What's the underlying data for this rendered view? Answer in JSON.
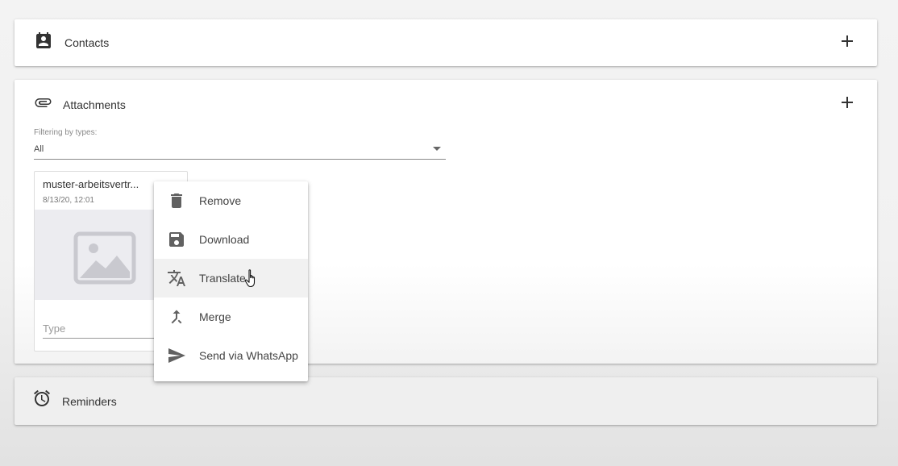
{
  "contacts": {
    "title": "Contacts",
    "icon": "contacts-icon",
    "add_icon": "plus-icon"
  },
  "attachments": {
    "title": "Attachments",
    "icon": "paperclip-icon",
    "add_icon": "plus-icon",
    "filter": {
      "label": "Filtering by types:",
      "value": "All"
    },
    "card": {
      "name": "muster-arbeitsvertr...",
      "date": "8/13/20, 12:01",
      "thumbnail_icon": "image-placeholder-icon",
      "type_placeholder": "Type"
    }
  },
  "context_menu": {
    "items": [
      {
        "label": "Remove",
        "icon": "trash-icon"
      },
      {
        "label": "Download",
        "icon": "save-icon"
      },
      {
        "label": "Translate",
        "icon": "translate-icon"
      },
      {
        "label": "Merge",
        "icon": "merge-icon"
      },
      {
        "label": "Send via WhatsApp",
        "icon": "send-icon"
      }
    ],
    "hovered": "Translate"
  },
  "reminders": {
    "title": "Reminders",
    "icon": "alarm-clock-icon"
  },
  "colors": {
    "icon": "#333333",
    "menu_icon": "#616161",
    "panel_bg": "#ffffff",
    "page_bg": "#f2f2f2",
    "hover_bg": "#f1f1f1"
  }
}
